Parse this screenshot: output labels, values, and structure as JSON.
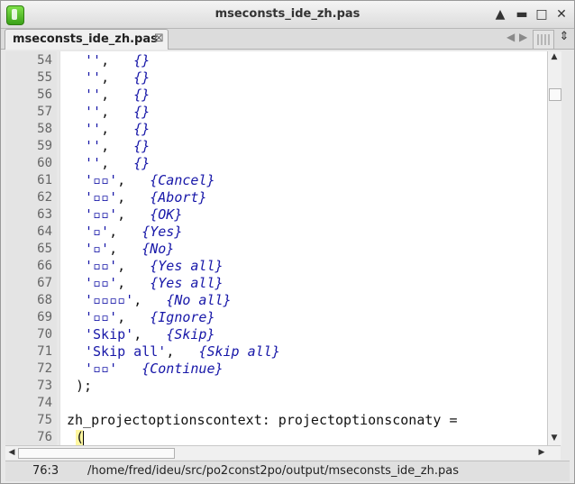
{
  "window": {
    "title": "mseconsts_ide_zh.pas"
  },
  "controls": {
    "minimize": "▲",
    "maximize": "□",
    "close": "✕"
  },
  "tab": {
    "label": "mseconsts_ide_zh.pas",
    "close_glyph": "⊠"
  },
  "nav": {
    "left": "◀",
    "right": "▶"
  },
  "tabtool2_glyph": "⇕",
  "gutter": {
    "line_numbers": [
      "54",
      "55",
      "56",
      "57",
      "58",
      "59",
      "60",
      "61",
      "62",
      "63",
      "64",
      "65",
      "66",
      "67",
      "68",
      "69",
      "70",
      "71",
      "72",
      "73",
      "74",
      "75",
      "76"
    ]
  },
  "code": {
    "l54": {
      "s": "''",
      "p": ",   ",
      "c": "{}"
    },
    "l55": {
      "s": "''",
      "p": ",   ",
      "c": "{}"
    },
    "l56": {
      "s": "''",
      "p": ",   ",
      "c": "{}"
    },
    "l57": {
      "s": "''",
      "p": ",   ",
      "c": "{}"
    },
    "l58": {
      "s": "''",
      "p": ",   ",
      "c": "{}"
    },
    "l59": {
      "s": "''",
      "p": ",   ",
      "c": "{}"
    },
    "l60": {
      "s": "''",
      "p": ",   ",
      "c": "{}"
    },
    "l61": {
      "s": "'▫▫'",
      "p": ",   ",
      "c": "{Cancel}"
    },
    "l62": {
      "s": "'▫▫'",
      "p": ",   ",
      "c": "{Abort}"
    },
    "l63": {
      "s": "'▫▫'",
      "p": ",   ",
      "c": "{OK}"
    },
    "l64": {
      "s": "'▫'",
      "p": ",   ",
      "c": "{Yes}"
    },
    "l65": {
      "s": "'▫'",
      "p": ",   ",
      "c": "{No}"
    },
    "l66": {
      "s": "'▫▫'",
      "p": ",   ",
      "c": "{Yes all}"
    },
    "l67": {
      "s": "'▫▫'",
      "p": ",   ",
      "c": "{Yes all}"
    },
    "l68": {
      "s": "'▫▫▫▫'",
      "p": ",   ",
      "c": "{No all}"
    },
    "l69": {
      "s": "'▫▫'",
      "p": ",   ",
      "c": "{Ignore}"
    },
    "l70": {
      "s": "'Skip'",
      "p": ",   ",
      "c": "{Skip}"
    },
    "l71": {
      "s": "'Skip all'",
      "p": ",   ",
      "c": "{Skip all}"
    },
    "l72": {
      "s": "'▫▫'",
      "p": "   ",
      "c": "{Continue}"
    },
    "l73": " );",
    "l74": "",
    "l75": "zh_projectoptionscontext: projectoptionsconaty =",
    "l76": " ("
  },
  "status": {
    "position": "76:3",
    "path": "/home/fred/ideu/src/po2const2po/output/mseconsts_ide_zh.pas"
  },
  "colors": {
    "string": "#1717a8",
    "comment": "#1717a8",
    "highlight": "#fff7a0"
  }
}
